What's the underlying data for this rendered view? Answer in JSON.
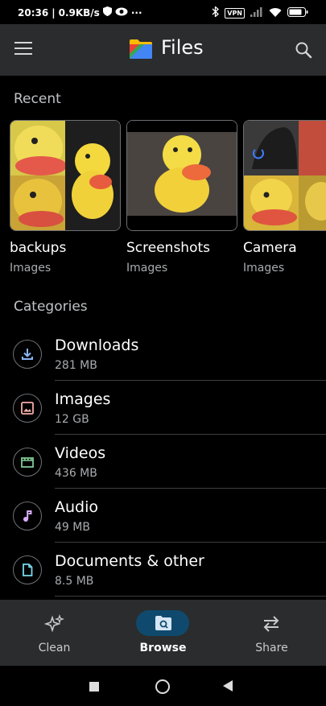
{
  "status": {
    "time": "20:36",
    "speed": "0.9KB/s",
    "dots": "···",
    "vpn": "VPN"
  },
  "appbar": {
    "title": "Files"
  },
  "recent": {
    "section_title": "Recent",
    "folders": [
      {
        "name": "backups",
        "type": "Images"
      },
      {
        "name": "Screenshots",
        "type": "Images"
      },
      {
        "name": "Camera",
        "type": "Images"
      }
    ]
  },
  "categories": {
    "section_title": "Categories",
    "items": [
      {
        "name": "Downloads",
        "size": "281 MB",
        "icon": "download-icon",
        "color": "#8ab4f8"
      },
      {
        "name": "Images",
        "size": "12 GB",
        "icon": "image-icon",
        "color": "#f6aea9"
      },
      {
        "name": "Videos",
        "size": "436 MB",
        "icon": "movie-icon",
        "color": "#81c995"
      },
      {
        "name": "Audio",
        "size": "49 MB",
        "icon": "music-note-icon",
        "color": "#d7aefb"
      },
      {
        "name": "Documents & other",
        "size": "8.5 MB",
        "icon": "document-icon",
        "color": "#78d9ec"
      }
    ]
  },
  "bottomnav": {
    "items": [
      {
        "label": "Clean",
        "icon": "sparkle-icon"
      },
      {
        "label": "Browse",
        "icon": "browse-icon",
        "selected": true
      },
      {
        "label": "Share",
        "icon": "swap-arrows-icon"
      }
    ],
    "selected_color": "#0f4a6e"
  }
}
